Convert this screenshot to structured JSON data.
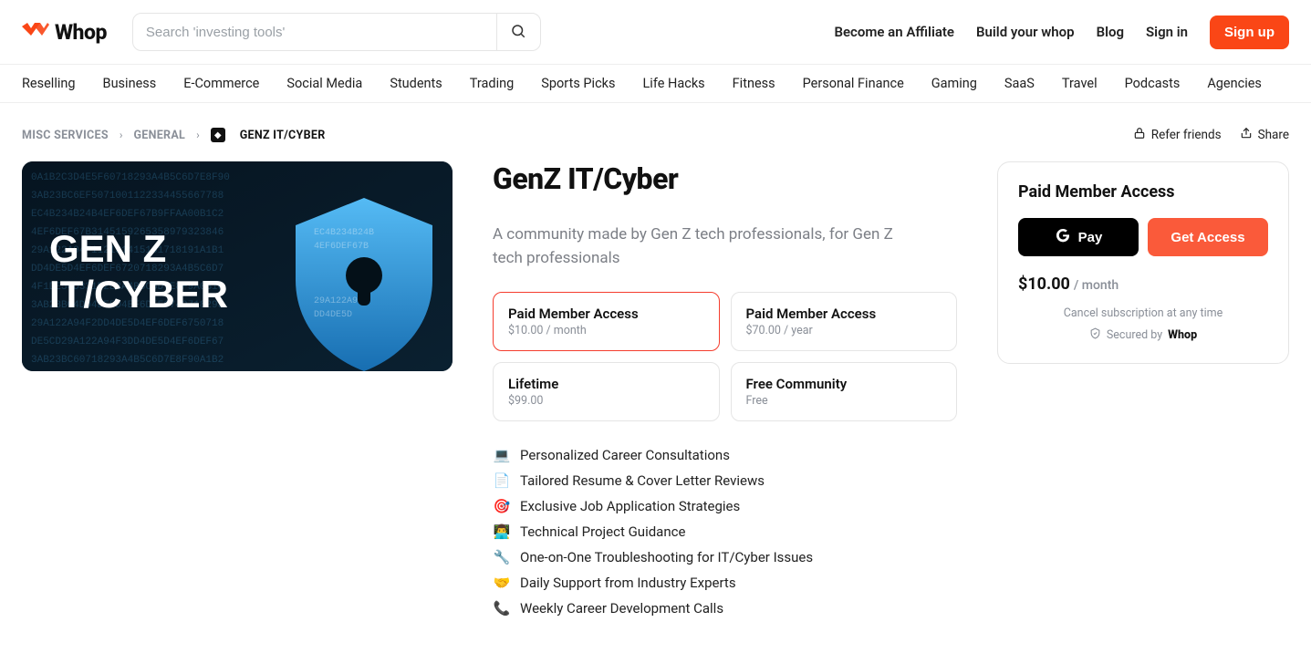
{
  "header": {
    "brand": "Whop",
    "search_placeholder": "Search 'investing tools'",
    "links": {
      "affiliate": "Become an Affiliate",
      "build": "Build your whop",
      "blog": "Blog",
      "signin": "Sign in",
      "signup": "Sign up"
    }
  },
  "categories": [
    "Reselling",
    "Business",
    "E-Commerce",
    "Social Media",
    "Students",
    "Trading",
    "Sports Picks",
    "Life Hacks",
    "Fitness",
    "Personal Finance",
    "Gaming",
    "SaaS",
    "Travel",
    "Podcasts",
    "Agencies"
  ],
  "breadcrumb": {
    "misc": "MISC SERVICES",
    "general": "GENERAL",
    "current": "GENZ IT/CYBER",
    "refer": "Refer friends",
    "share": "Share"
  },
  "hero": {
    "line1": "GEN Z",
    "line2": "IT/CYBER"
  },
  "product": {
    "title": "GenZ IT/Cyber",
    "subtitle": "A community made by Gen Z tech professionals, for Gen Z tech professionals"
  },
  "plans": [
    {
      "title": "Paid Member Access",
      "price": "$10.00 / month",
      "selected": true
    },
    {
      "title": "Paid Member Access",
      "price": "$70.00 / year",
      "selected": false
    },
    {
      "title": "Lifetime",
      "price": "$99.00",
      "selected": false
    },
    {
      "title": "Free Community",
      "price": "Free",
      "selected": false
    }
  ],
  "features": [
    {
      "emoji": "💻",
      "text": "Personalized Career Consultations"
    },
    {
      "emoji": "📄",
      "text": "Tailored Resume & Cover Letter Reviews"
    },
    {
      "emoji": "🎯",
      "text": "Exclusive Job Application Strategies"
    },
    {
      "emoji": "👨‍💻",
      "text": "Technical Project Guidance"
    },
    {
      "emoji": "🔧",
      "text": "One-on-One Troubleshooting for IT/Cyber Issues"
    },
    {
      "emoji": "🤝",
      "text": "Daily Support from Industry Experts"
    },
    {
      "emoji": "📞",
      "text": "Weekly Career Development Calls"
    }
  ],
  "sidebar": {
    "title": "Paid Member Access",
    "gpay": "Pay",
    "access": "Get Access",
    "price": "$10.00",
    "period": "/ month",
    "cancel": "Cancel subscription at any time",
    "secured": "Secured by",
    "secured_brand": "Whop"
  }
}
